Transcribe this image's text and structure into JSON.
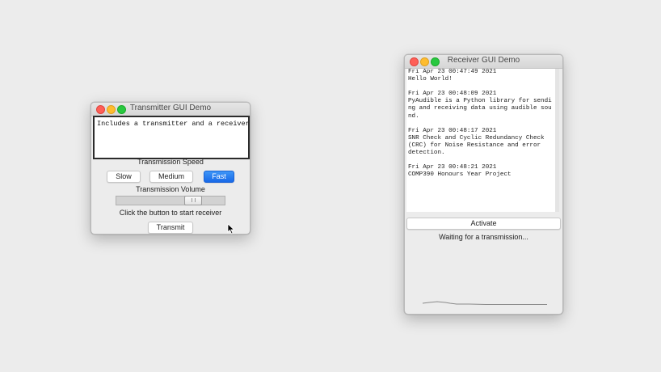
{
  "transmitter": {
    "title": "Transmitter GUI Demo",
    "text_value": "Includes a transmitter and a receiver",
    "speed_label": "Transmission Speed",
    "speed_options": [
      "Slow",
      "Medium",
      "Fast"
    ],
    "speed_selected": "Fast",
    "volume_label": "Transmission Volume",
    "volume_level": 0.75,
    "hint": "Click the button to start receiver",
    "transmit_button": "Transmit"
  },
  "receiver": {
    "title": "Receiver GUI Demo",
    "log": [
      {
        "time": "Fri Apr 23 00:47:49 2021",
        "message": "Hello World!"
      },
      {
        "time": "Fri Apr 23 00:48:09 2021",
        "message": "PyAudible is a Python library for sending and receiving data using audible sound."
      },
      {
        "time": "Fri Apr 23 00:48:17 2021",
        "message": "SNR Check and Cyclic Redundancy Check (CRC) for Noise Resistance and error detection."
      },
      {
        "time": "Fri Apr 23 00:48:21 2021",
        "message": "COMP390 Honours Year Project"
      }
    ],
    "activate_button": "Activate",
    "status": "Waiting for a transmission..."
  },
  "colors": {
    "accent": "#1869e8",
    "close": "#fe5f57",
    "minimize": "#febc2e",
    "zoom": "#28c840"
  }
}
